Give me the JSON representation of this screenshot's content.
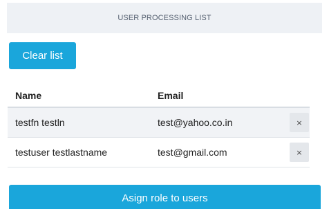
{
  "panel": {
    "title": "USER PROCESSING LIST"
  },
  "toolbar": {
    "clear_label": "Clear list"
  },
  "table": {
    "columns": [
      "Name",
      "Email"
    ],
    "rows": [
      {
        "name": "testfn testln",
        "email": "test@yahoo.co.in",
        "remove_label": "×"
      },
      {
        "name": "testuser testlastname",
        "email": "test@gmail.com",
        "remove_label": "×"
      }
    ]
  },
  "footer": {
    "assign_label": "Asign role to users"
  },
  "colors": {
    "accent": "#1aa6db",
    "header_bg": "#eef1f5",
    "row_alt_bg": "#f1f3f6"
  }
}
